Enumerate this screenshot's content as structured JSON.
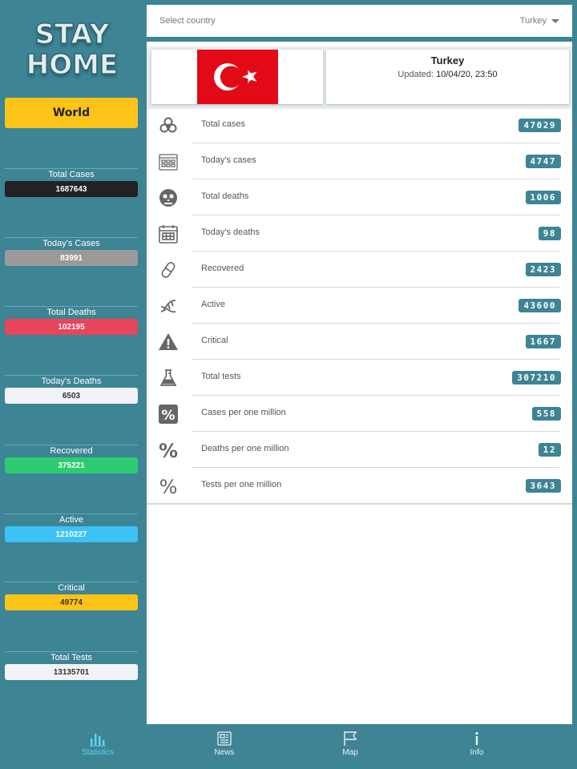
{
  "logo": {
    "line1": "STAY",
    "line2": "HOME"
  },
  "sidebar": {
    "world_button": "World",
    "stats": [
      {
        "label": "Total Cases",
        "value": "1687643",
        "bg": "#222222",
        "fg": "#ffffff"
      },
      {
        "label": "Today's Cases",
        "value": "83991",
        "bg": "#9a9a9a",
        "fg": "#ffffff"
      },
      {
        "label": "Total Deaths",
        "value": "102195",
        "bg": "#e8445a",
        "fg": "#ffffff"
      },
      {
        "label": "Today's Deaths",
        "value": "6503",
        "bg": "#f1f3f6",
        "fg": "#333333"
      },
      {
        "label": "Recovered",
        "value": "375221",
        "bg": "#2ecc71",
        "fg": "#ffffff"
      },
      {
        "label": "Active",
        "value": "1210227",
        "bg": "#3cc2f5",
        "fg": "#ffffff"
      },
      {
        "label": "Critical",
        "value": "49774",
        "bg": "#fcc419",
        "fg": "#333333"
      },
      {
        "label": "Total Tests",
        "value": "13135701",
        "bg": "#f1f3f6",
        "fg": "#333333"
      }
    ]
  },
  "country_select": {
    "placeholder": "Select country",
    "selected": "Turkey"
  },
  "header": {
    "country": "Turkey",
    "updated_label": "Updated:",
    "updated_value": "10/04/20, 23:50"
  },
  "rows": [
    {
      "icon": "biohazard-icon",
      "label": "Total cases",
      "value": "47029"
    },
    {
      "icon": "calendar-grid-icon",
      "label": "Today's cases",
      "value": "4747"
    },
    {
      "icon": "skull-icon",
      "label": "Total deaths",
      "value": "1006"
    },
    {
      "icon": "calendar-icon",
      "label": "Today's deaths",
      "value": "98"
    },
    {
      "icon": "pill-icon",
      "label": "Recovered",
      "value": "2423"
    },
    {
      "icon": "dna-icon",
      "label": "Active",
      "value": "43600"
    },
    {
      "icon": "warning-icon",
      "label": "Critical",
      "value": "1667"
    },
    {
      "icon": "flask-icon",
      "label": "Total tests",
      "value": "307210"
    },
    {
      "icon": "percent-box-icon",
      "label": "Cases per one million",
      "value": "558"
    },
    {
      "icon": "percent-bold-icon",
      "label": "Deaths per one million",
      "value": "12"
    },
    {
      "icon": "percent-icon",
      "label": "Tests per one million",
      "value": "3643"
    }
  ],
  "nav": [
    {
      "icon": "bar-chart-icon",
      "label": "Statistics",
      "active": true
    },
    {
      "icon": "newspaper-icon",
      "label": "News",
      "active": false
    },
    {
      "icon": "flag-icon",
      "label": "Map",
      "active": false
    },
    {
      "icon": "info-icon",
      "label": "Info",
      "active": false
    }
  ],
  "colors": {
    "primary": "#3d8494",
    "accent": "#fcc419",
    "flag_red": "#e30a17",
    "active_nav": "#5ed4f2"
  }
}
